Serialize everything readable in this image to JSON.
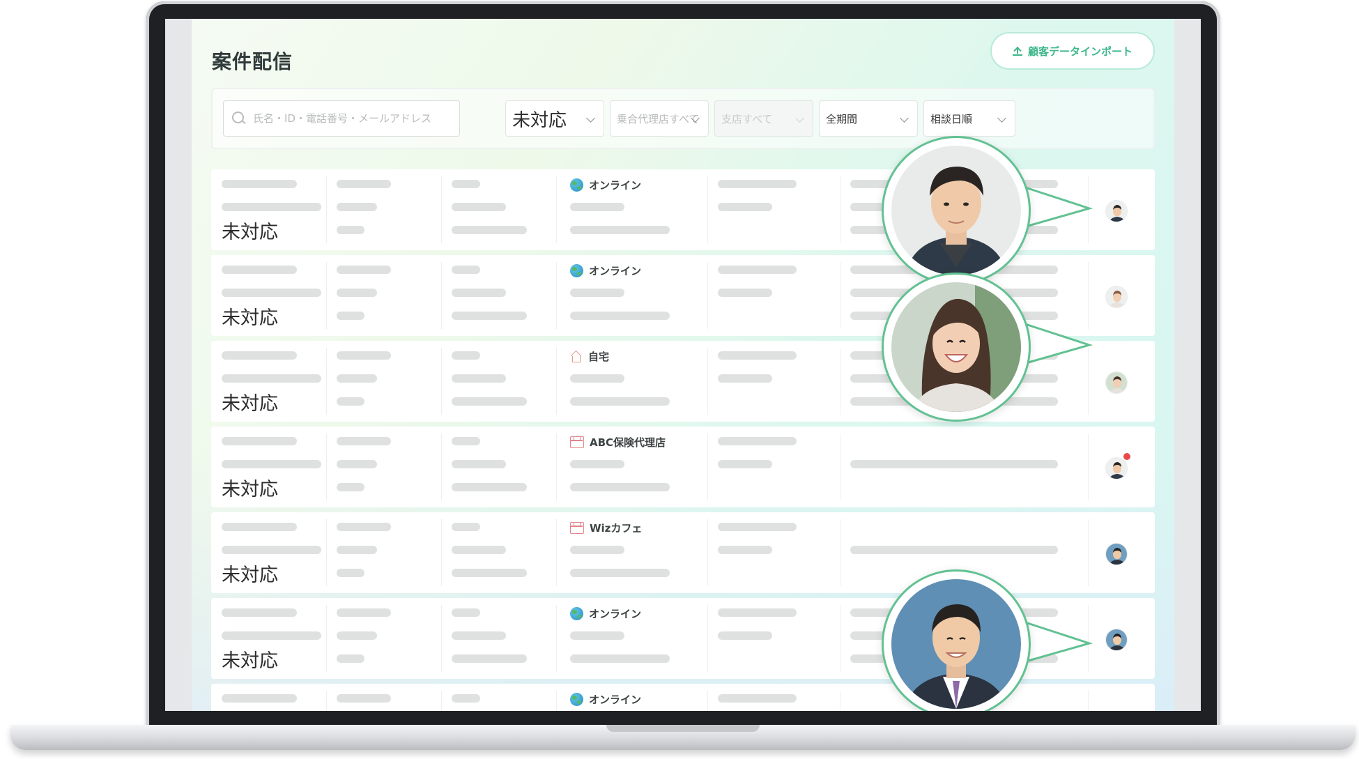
{
  "page": {
    "title": "案件配信",
    "import_button": "顧客データインポート"
  },
  "filters": {
    "search_placeholder": "氏名・ID・電話番号・メールアドレス",
    "status": "未対応",
    "agency": "乗合代理店すべて",
    "branch": "支店すべて",
    "period": "全期間",
    "sort": "相談日順"
  },
  "rows": [
    {
      "status": "未対応",
      "location": "オンライン",
      "location_icon": "globe-icon"
    },
    {
      "status": "未対応",
      "location": "オンライン",
      "location_icon": "globe-icon"
    },
    {
      "status": "未対応",
      "location": "自宅",
      "location_icon": "home-icon"
    },
    {
      "status": "未対応",
      "location": "ABC保険代理店",
      "location_icon": "store-icon",
      "notification": true
    },
    {
      "status": "未対応",
      "location": "Wizカフェ",
      "location_icon": "store-icon"
    },
    {
      "status": "未対応",
      "location": "オンライン",
      "location_icon": "globe-icon"
    },
    {
      "status": "",
      "location": "オンライン",
      "location_icon": "globe-icon"
    }
  ],
  "colors": {
    "accent": "#3bb68a",
    "callout_border": "#62c192",
    "notification": "#e84949"
  }
}
